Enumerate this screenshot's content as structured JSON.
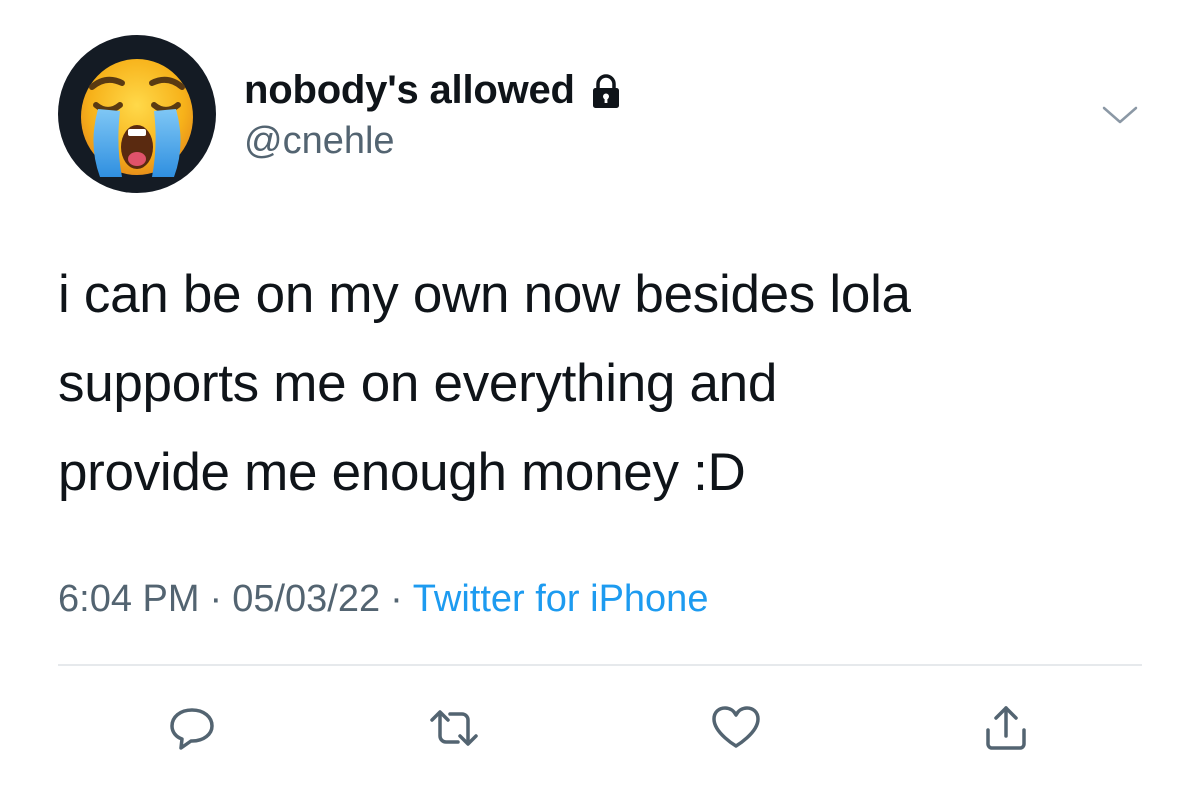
{
  "author": {
    "display_name": "nobody's allowed",
    "handle": "@cnehle",
    "avatar_icon": "loudly-crying-face-icon",
    "protected_icon": "lock-icon"
  },
  "tweet": {
    "text": "i can be on my own now besides lola\nsupports me on everything and\nprovide me enough money :D",
    "time": "6:04 PM",
    "date": "05/03/22",
    "separator": "·",
    "source": "Twitter for iPhone"
  },
  "actions": [
    {
      "name": "reply",
      "icon": "reply-icon"
    },
    {
      "name": "retweet",
      "icon": "retweet-icon"
    },
    {
      "name": "like",
      "icon": "heart-icon"
    },
    {
      "name": "share",
      "icon": "share-icon"
    }
  ],
  "colors": {
    "text_primary": "#0f1419",
    "text_secondary": "#536471",
    "link": "#1d9bf0",
    "divider": "#e6e9ec",
    "avatar_bg": "#141b24"
  }
}
